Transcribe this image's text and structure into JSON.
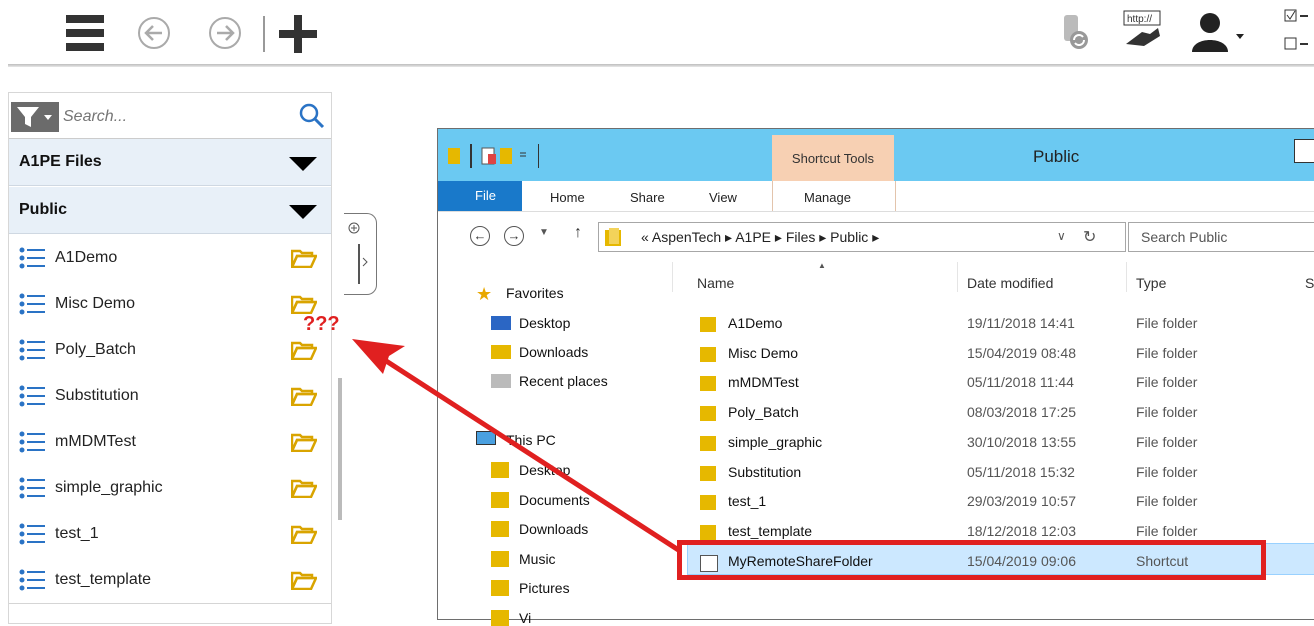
{
  "navigator": {
    "search_placeholder": "Search...",
    "headers": [
      "A1PE Files",
      "Public"
    ],
    "items": [
      "A1Demo",
      "Misc Demo",
      "Poly_Batch",
      "Substitution",
      "mMDMTest",
      "simple_graphic",
      "test_1",
      "test_template"
    ]
  },
  "annotation": {
    "question": "???"
  },
  "explorer": {
    "title": "Public",
    "contextual_tab": "Shortcut Tools",
    "ribbon_tabs": [
      "File",
      "Home",
      "Share",
      "View",
      "Manage"
    ],
    "breadcrumb": "« AspenTech ▸ A1PE ▸ Files ▸ Public ▸",
    "search_placeholder": "Search Public",
    "columns": [
      "Name",
      "Date modified",
      "Type",
      "S"
    ],
    "nav_pane": {
      "favorites_label": "Favorites",
      "favorites": [
        "Desktop",
        "Downloads",
        "Recent places"
      ],
      "thispc_label": "This PC",
      "thispc": [
        "Desktop",
        "Documents",
        "Downloads",
        "Music",
        "Pictures",
        "Vi"
      ]
    },
    "files": [
      {
        "name": "A1Demo",
        "date": "19/11/2018 14:41",
        "type": "File folder"
      },
      {
        "name": "Misc Demo",
        "date": "15/04/2019 08:48",
        "type": "File folder"
      },
      {
        "name": "mMDMTest",
        "date": "05/11/2018 11:44",
        "type": "File folder"
      },
      {
        "name": "Poly_Batch",
        "date": "08/03/2018 17:25",
        "type": "File folder"
      },
      {
        "name": "simple_graphic",
        "date": "30/10/2018 13:55",
        "type": "File folder"
      },
      {
        "name": "Substitution",
        "date": "05/11/2018 15:32",
        "type": "File folder"
      },
      {
        "name": "test_1",
        "date": "29/03/2019 10:57",
        "type": "File folder"
      },
      {
        "name": "test_template",
        "date": "18/12/2018 12:03",
        "type": "File folder"
      },
      {
        "name": "MyRemoteShareFolder",
        "date": "15/04/2019 09:06",
        "type": "Shortcut"
      }
    ]
  },
  "colors": {
    "accent_blue": "#1979ca",
    "title_blue": "#6bc9f2",
    "annotation_red": "#e02020",
    "folder_yellow": "#e6b800"
  }
}
